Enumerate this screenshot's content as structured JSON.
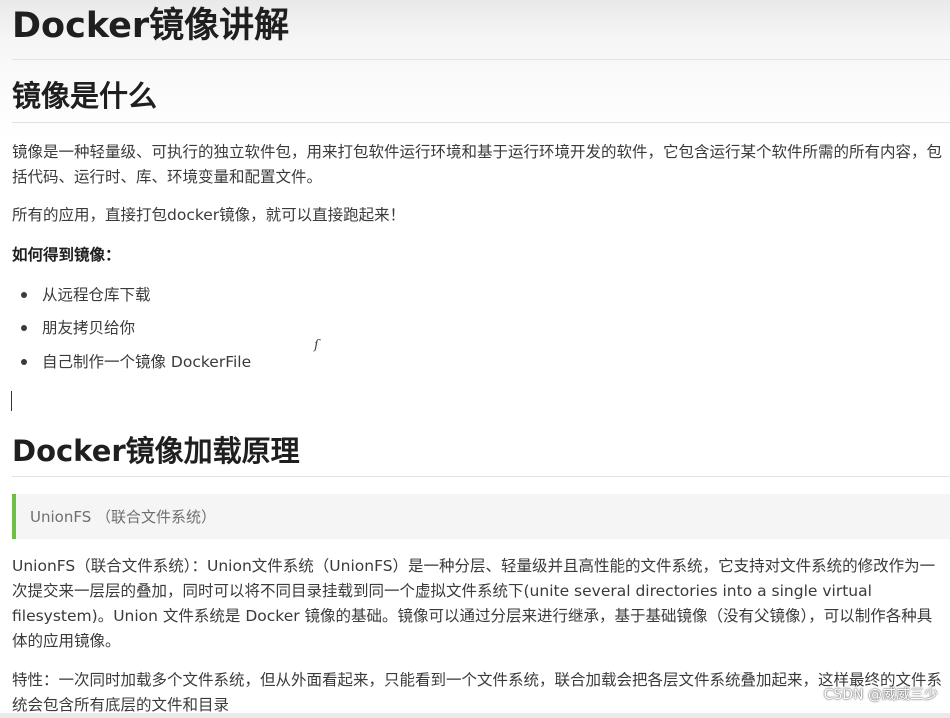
{
  "title": "Docker镜像讲解",
  "section1": {
    "heading": "镜像是什么",
    "paragraph1": "镜像是一种轻量级、可执行的独立软件包，用来打包软件运行环境和基于运行环境开发的软件，它包含运行某个软件所需的所有内容，包括代码、运行时、库、环境变量和配置文件。",
    "paragraph2": "所有的应用，直接打包docker镜像，就可以直接跑起来！",
    "subheading": "如何得到镜像：",
    "list": [
      "从远程仓库下载",
      "朋友拷贝给你",
      "自己制作一个镜像 DockerFile"
    ]
  },
  "section2": {
    "heading": "Docker镜像加载原理",
    "quote": "UnionFS （联合文件系统）",
    "paragraph1": "UnionFS（联合文件系统）：Union文件系统（UnionFS）是一种分层、轻量级并且高性能的文件系统，它支持对文件系统的修改作为一次提交来一层层的叠加，同时可以将不同目录挂载到同一个虚拟文件系统下(unite several directories into a single virtual filesystem)。Union 文件系统是 Docker 镜像的基础。镜像可以通过分层来进行继承，基于基础镜像（没有父镜像），可以制作各种具体的应用镜像。",
    "paragraph2": "特性：一次同时加载多个文件系统，但从外面看起来，只能看到一个文件系统，联合加载会把各层文件系统叠加起来，这样最终的文件系统会包含所有底层的文件和目录"
  },
  "watermark": "CSDN @威威三少",
  "colors": {
    "quote_border": "#6cbf45",
    "quote_bg": "#f5f5f5",
    "text": "#3a3a3a"
  }
}
